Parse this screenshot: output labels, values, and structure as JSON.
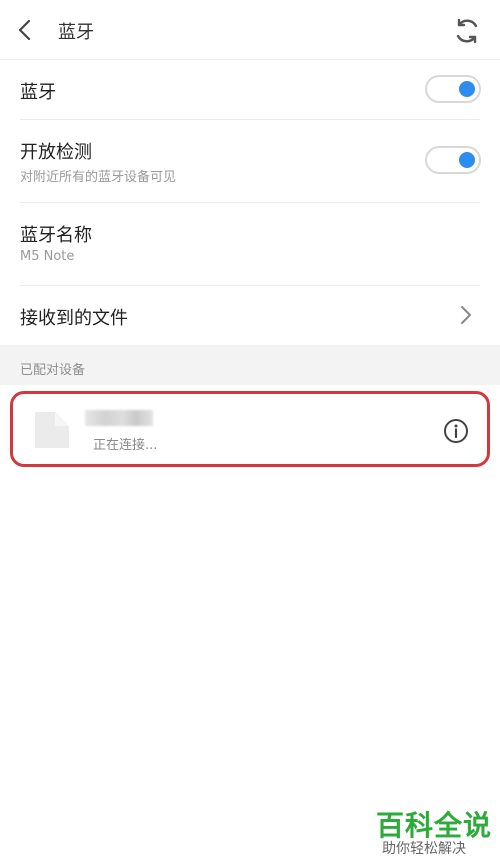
{
  "header": {
    "title": "蓝牙",
    "back_icon": "chevron-left-icon",
    "refresh_icon": "refresh-icon"
  },
  "settings": {
    "bluetooth": {
      "label": "蓝牙",
      "enabled": true
    },
    "discoverable": {
      "label": "开放检测",
      "description": "对附近所有的蓝牙设备可见",
      "enabled": true
    },
    "device_name": {
      "label": "蓝牙名称",
      "value": "M5 Note"
    },
    "received_files": {
      "label": "接收到的文件"
    }
  },
  "paired_devices": {
    "section_label": "已配对设备",
    "items": [
      {
        "status": "正在连接..."
      }
    ]
  },
  "watermark": {
    "title": "百科全说",
    "subtitle": "助你轻松解决"
  },
  "colors": {
    "accent": "#2d8cf0",
    "highlight_border": "#d4373d",
    "watermark_green": "#2eaa3b"
  }
}
